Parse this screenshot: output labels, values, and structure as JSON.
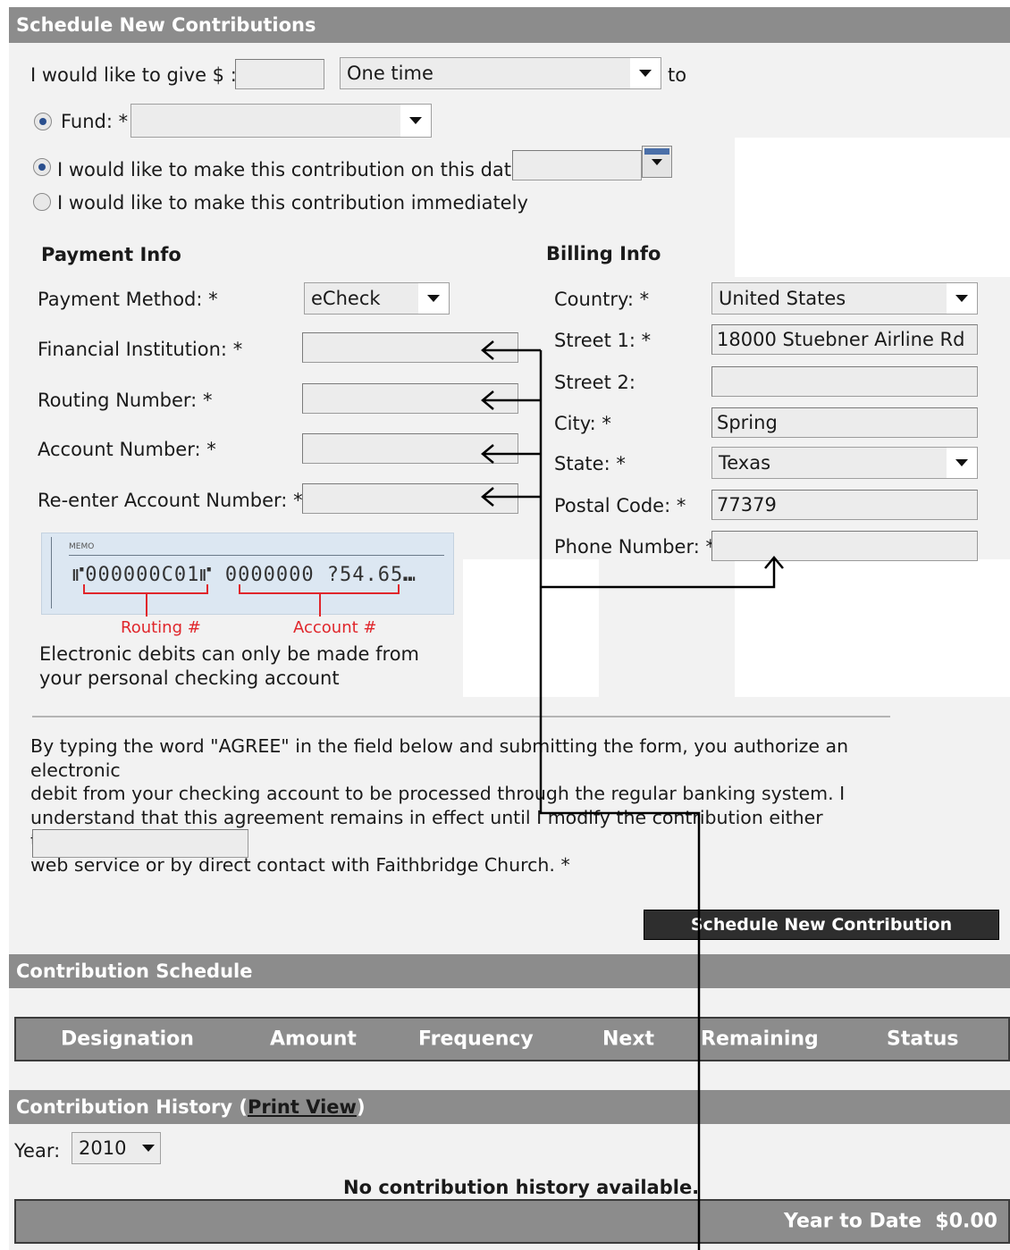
{
  "schedule_section": {
    "title": "Schedule New Contributions",
    "give_label": "I would like to give $ :",
    "required_mark": "*",
    "amount_value": "",
    "frequency_value": "One time",
    "to_label": "to",
    "fund_label": "Fund:",
    "fund_value": "",
    "date_option_label": "I would like to make this contribution on this date:",
    "date_value": "",
    "immediate_option_label": "I would like to make this contribution immediately"
  },
  "payment_info": {
    "title": "Payment Info",
    "method_label": "Payment Method:",
    "method_value": "eCheck",
    "institution_label": "Financial Institution:",
    "routing_label": "Routing Number:",
    "account_label": "Account Number:",
    "reenter_label": "Re-enter Account Number:",
    "check_memo": "MEMO",
    "check_micr": "⑈000000C01⑈ 0000000 ?54.65⑉",
    "routing_caption": "Routing #",
    "account_caption": "Account #",
    "note": "Electronic debits can only be made from your personal checking account"
  },
  "billing_info": {
    "title": "Billing Info",
    "country_label": "Country:",
    "country_value": "United States",
    "street1_label": "Street 1:",
    "street1_value": "18000 Stuebner Airline Rd",
    "street2_label": "Street 2:",
    "street2_value": "",
    "city_label": "City:",
    "city_value": "Spring",
    "state_label": "State:",
    "state_value": "Texas",
    "postal_label": "Postal Code:",
    "postal_value": "77379",
    "phone_label": "Phone Number:",
    "phone_value": ""
  },
  "agreement": {
    "text_line1": "By typing the word \"AGREE\" in the field below and submitting the form, you authorize an electronic",
    "text_line2": "debit from your checking account to be processed through the regular banking system. I",
    "text_line3": "understand that this agreement remains in effect until I modify the contribution either through this",
    "text_line4": "web service or by direct contact with Faithbridge Church.",
    "value": ""
  },
  "submit_button": "Schedule New Contribution",
  "contribution_schedule": {
    "title": "Contribution Schedule",
    "columns": [
      "Designation",
      "Amount",
      "Frequency",
      "Next",
      "Remaining",
      "Status"
    ]
  },
  "contribution_history": {
    "title": "Contribution History (",
    "print_view": "Print View",
    "title_close": ")",
    "year_label": "Year:",
    "year_value": "2010",
    "empty_message": "No contribution history available.",
    "ytd_label": "Year to Date",
    "ytd_value": "$0.00"
  },
  "colors": {
    "section_bar": "#8c8c8c",
    "panel_bg": "#f2f2f2",
    "check_red": "#e0262b",
    "dark_button": "#2e2e2e"
  }
}
